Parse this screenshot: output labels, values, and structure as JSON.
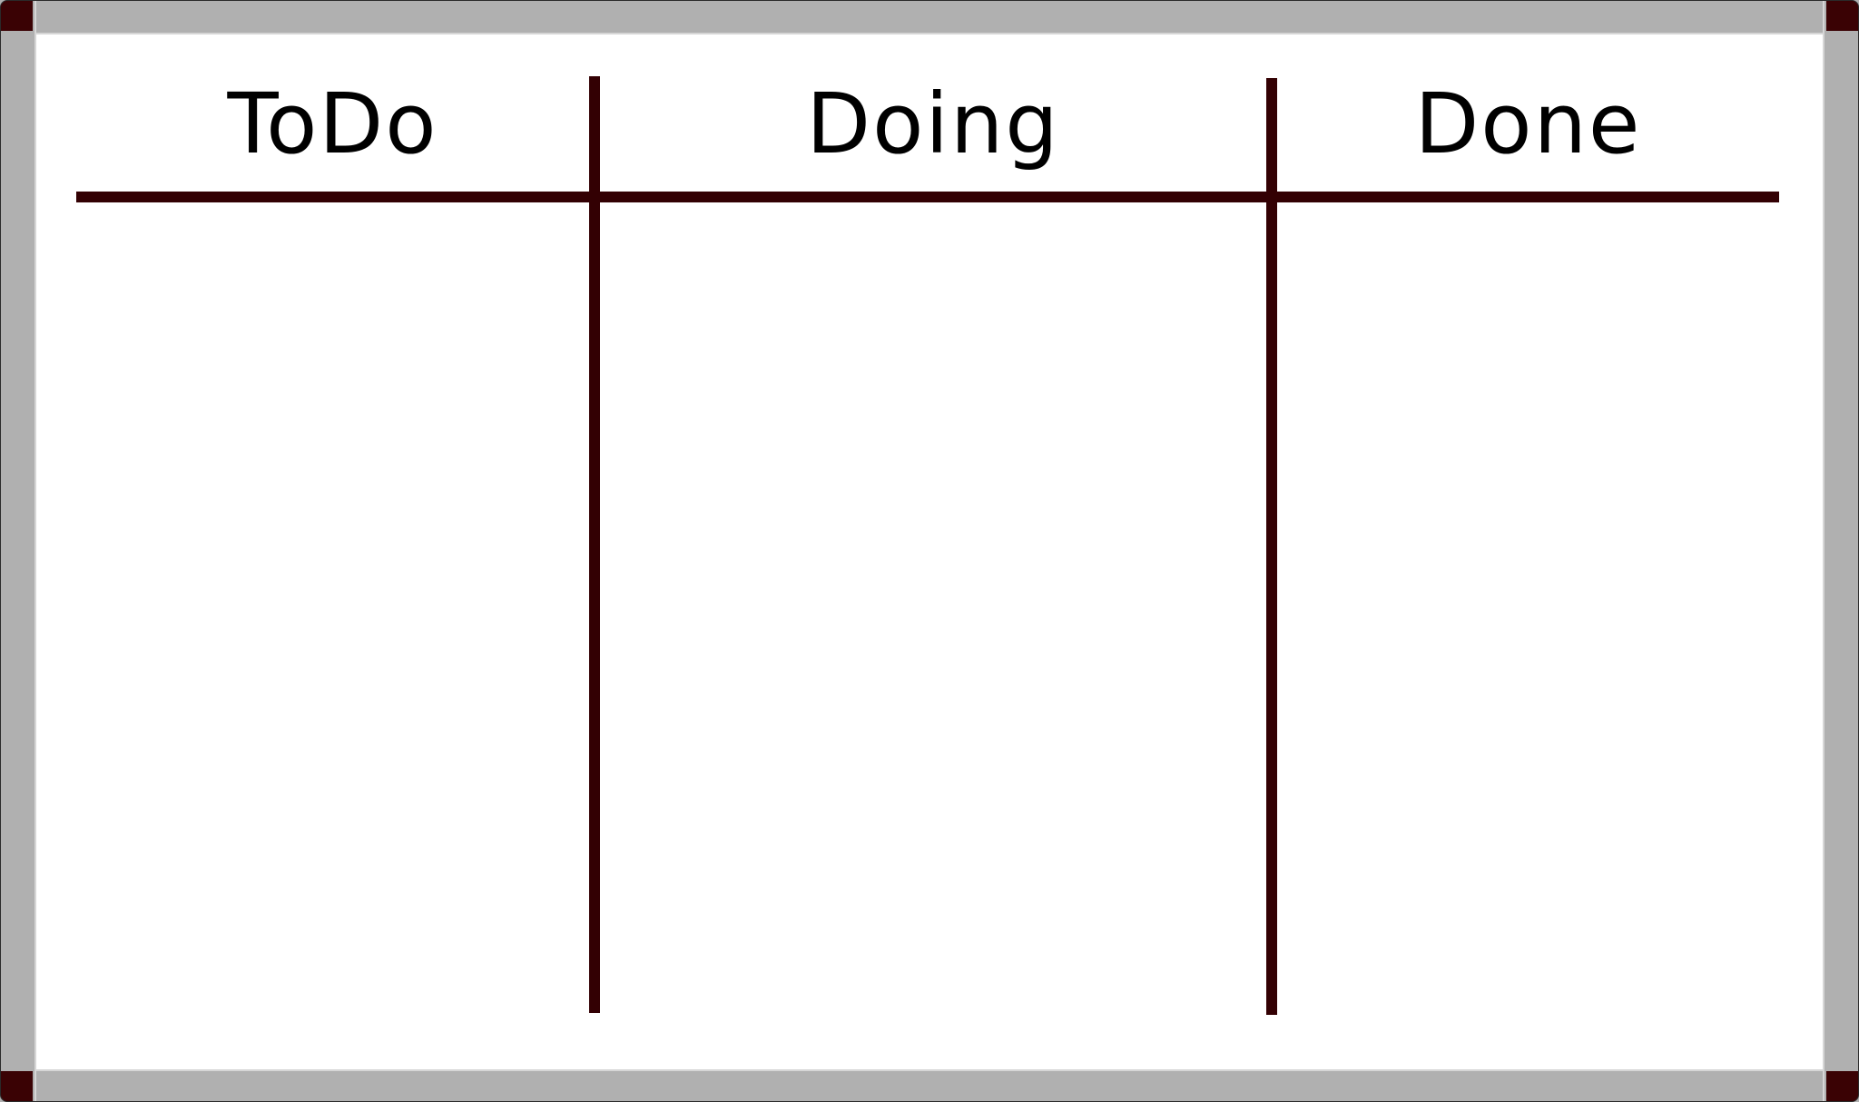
{
  "board": {
    "columns": [
      {
        "label": "ToDo"
      },
      {
        "label": "Doing"
      },
      {
        "label": "Done"
      }
    ]
  },
  "colors": {
    "frame": "#b0b0b0",
    "frame_highlight": "#d6d6d6",
    "corner_caps": "#3a0204",
    "marker_lines": "#330003",
    "surface": "#ffffff",
    "text": "#000000"
  }
}
